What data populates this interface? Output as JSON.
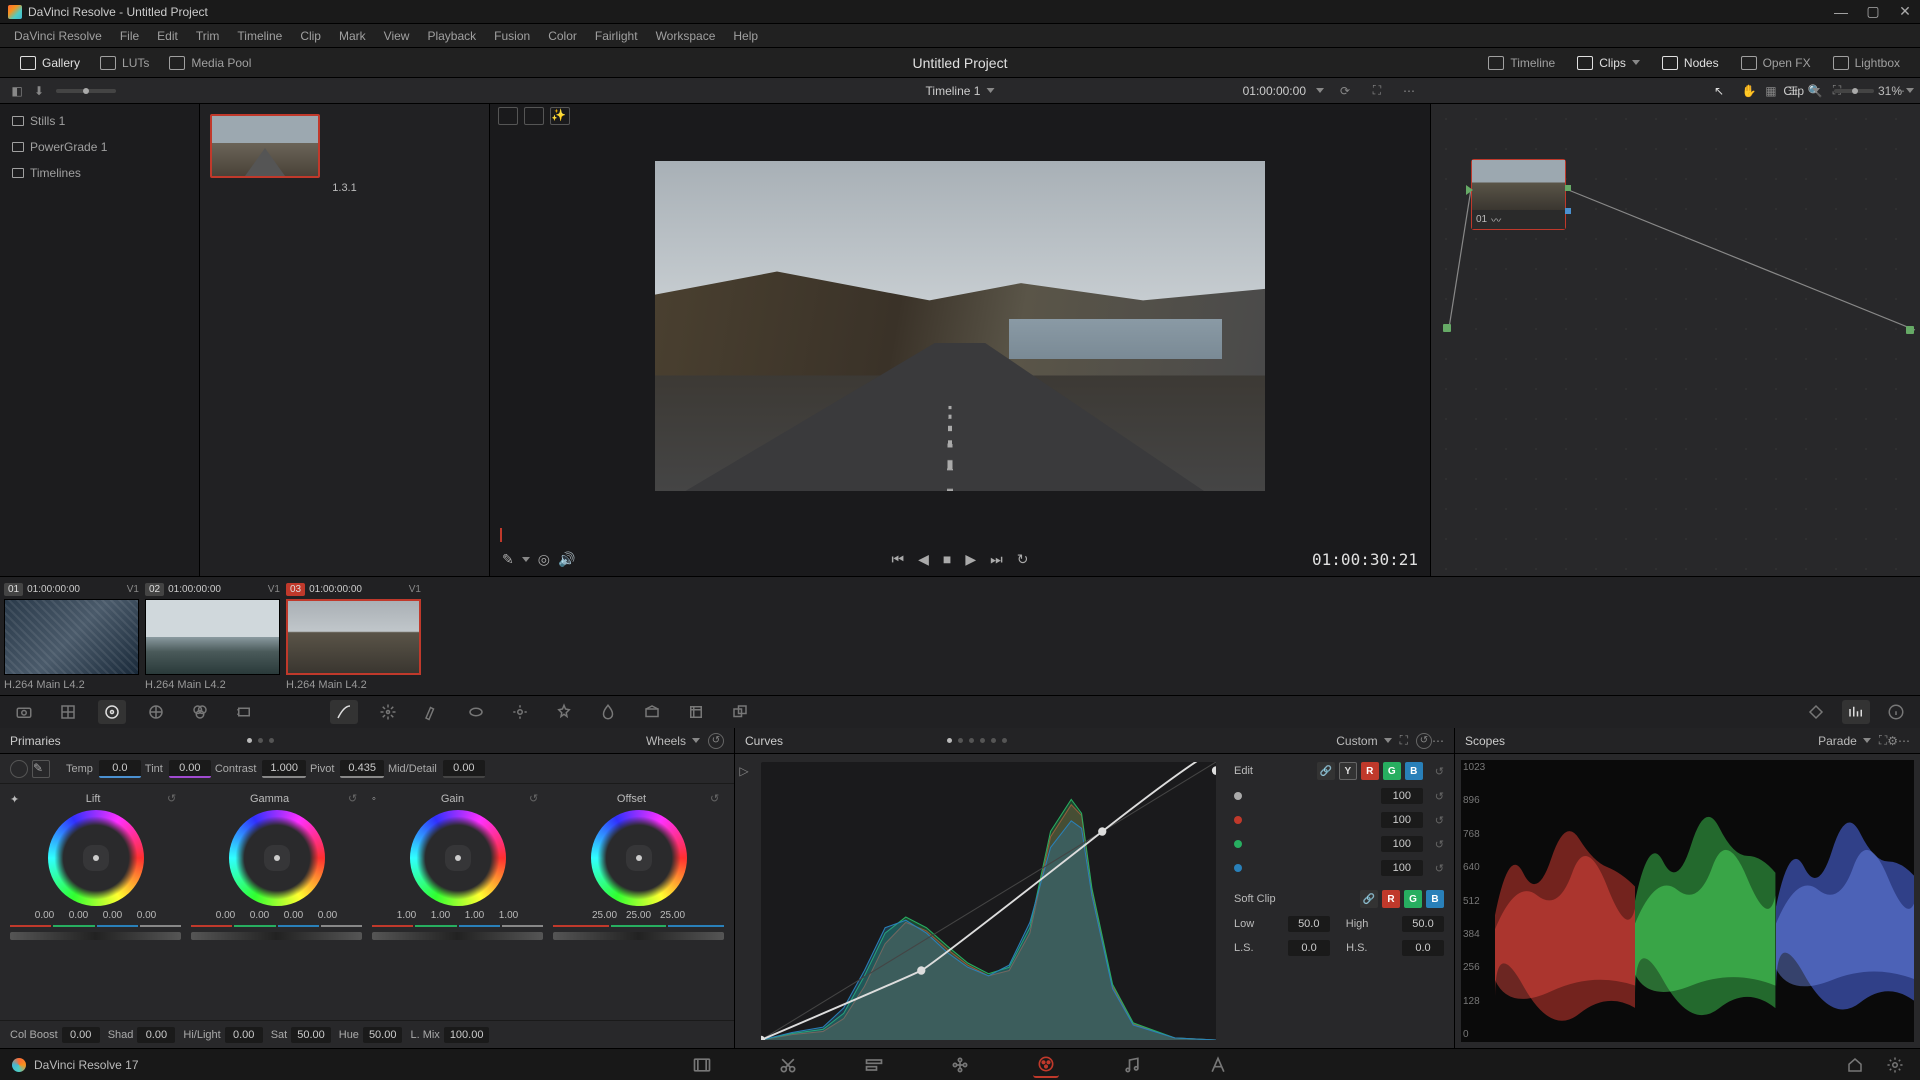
{
  "app": {
    "title": "DaVinci Resolve - Untitled Project",
    "version_label": "DaVinci Resolve 17"
  },
  "menu": [
    "DaVinci Resolve",
    "File",
    "Edit",
    "Trim",
    "Timeline",
    "Clip",
    "Mark",
    "View",
    "Playback",
    "Fusion",
    "Color",
    "Fairlight",
    "Workspace",
    "Help"
  ],
  "toolbar": {
    "gallery": "Gallery",
    "luts": "LUTs",
    "media_pool": "Media Pool",
    "timeline": "Timeline",
    "clips": "Clips",
    "nodes": "Nodes",
    "openfx": "Open FX",
    "lightbox": "Lightbox",
    "project_title": "Untitled Project"
  },
  "toolbar2": {
    "zoom": "31%",
    "timeline_name": "Timeline 1",
    "timecode": "01:00:00:00",
    "clip_label": "Clip"
  },
  "gallery": {
    "items": [
      "Stills 1",
      "PowerGrade 1",
      "Timelines"
    ],
    "still_label": "1.3.1"
  },
  "viewer": {
    "duration_tc": "01:00:30:21"
  },
  "node": {
    "label": "01"
  },
  "clips": [
    {
      "num": "01",
      "tc": "01:00:00:00",
      "track": "V1",
      "codec": "H.264 Main L4.2",
      "thumb": "water"
    },
    {
      "num": "02",
      "tc": "01:00:00:00",
      "track": "V1",
      "codec": "H.264 Main L4.2",
      "thumb": "lake"
    },
    {
      "num": "03",
      "tc": "01:00:00:00",
      "track": "V1",
      "codec": "H.264 Main L4.2",
      "thumb": "road",
      "active": true
    }
  ],
  "primaries": {
    "title": "Primaries",
    "mode": "Wheels",
    "temp_label": "Temp",
    "temp": "0.0",
    "tint_label": "Tint",
    "tint": "0.00",
    "contrast_label": "Contrast",
    "contrast": "1.000",
    "pivot_label": "Pivot",
    "pivot": "0.435",
    "md_label": "Mid/Detail",
    "md": "0.00",
    "wheels": {
      "lift": {
        "label": "Lift",
        "vals": [
          "0.00",
          "0.00",
          "0.00",
          "0.00"
        ]
      },
      "gamma": {
        "label": "Gamma",
        "vals": [
          "0.00",
          "0.00",
          "0.00",
          "0.00"
        ]
      },
      "gain": {
        "label": "Gain",
        "vals": [
          "1.00",
          "1.00",
          "1.00",
          "1.00"
        ]
      },
      "offset": {
        "label": "Offset",
        "vals": [
          "25.00",
          "25.00",
          "25.00"
        ]
      }
    },
    "row2": {
      "colboost_l": "Col Boost",
      "colboost": "0.00",
      "shad_l": "Shad",
      "shad": "0.00",
      "hilight_l": "Hi/Light",
      "hilight": "0.00",
      "sat_l": "Sat",
      "sat": "50.00",
      "hue_l": "Hue",
      "hue": "50.00",
      "lmix_l": "L. Mix",
      "lmix": "100.00"
    }
  },
  "curves": {
    "title": "Curves",
    "mode": "Custom",
    "edit_label": "Edit",
    "ch_vals": [
      "100",
      "100",
      "100",
      "100"
    ],
    "softclip_label": "Soft Clip",
    "low_l": "Low",
    "low": "50.0",
    "high_l": "High",
    "high": "50.0",
    "ls_l": "L.S.",
    "ls": "0.0",
    "hs_l": "H.S.",
    "hs": "0.0"
  },
  "scopes": {
    "title": "Scopes",
    "mode": "Parade",
    "scale": [
      "1023",
      "896",
      "768",
      "640",
      "512",
      "384",
      "256",
      "128",
      "0"
    ]
  }
}
